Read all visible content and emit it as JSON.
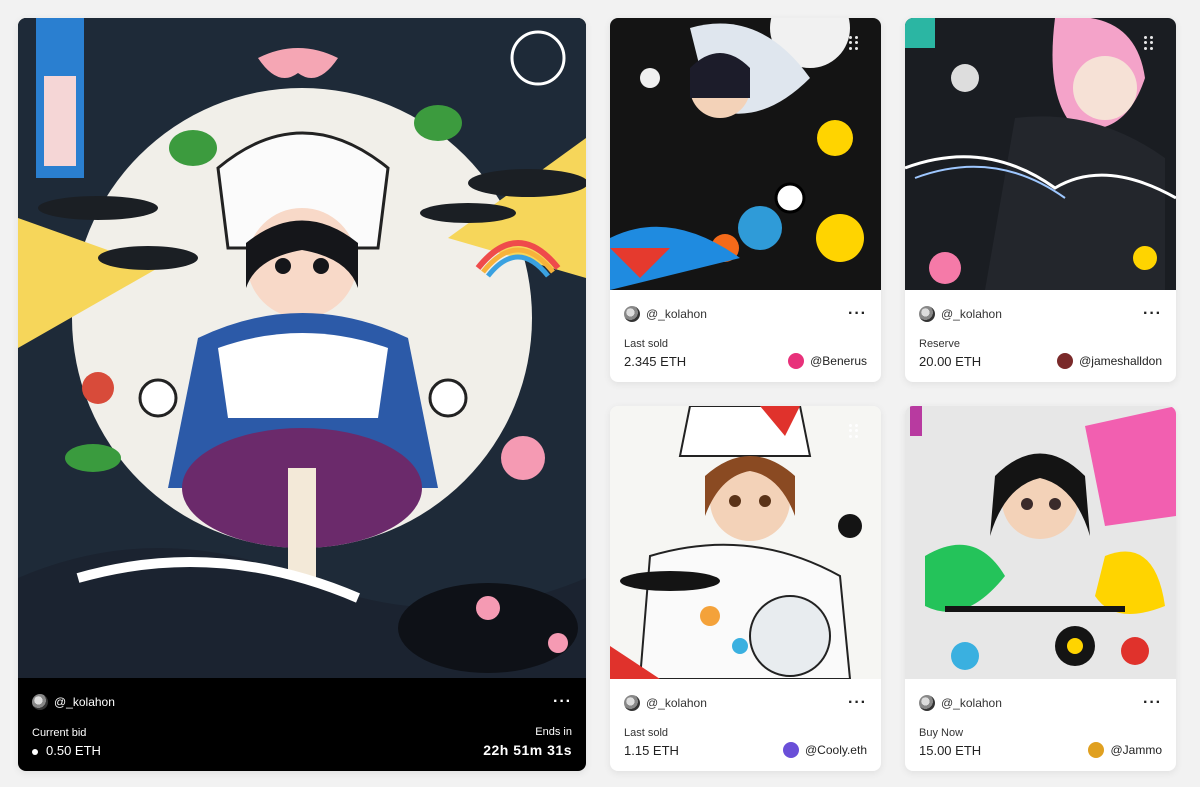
{
  "cards": [
    {
      "creator": "@_kolahon",
      "price_label": "Current bid",
      "price_value": "0.50 ETH",
      "timer_label": "Ends in",
      "timer_value": "22h  51m  31s"
    },
    {
      "creator": "@_kolahon",
      "price_label": "Last sold",
      "price_value": "2.345 ETH",
      "owner": "@Benerus",
      "owner_color": "#e8317a"
    },
    {
      "creator": "@_kolahon",
      "price_label": "Reserve",
      "price_value": "20.00 ETH",
      "owner": "@jameshalldon",
      "owner_color": "#7a2a2a"
    },
    {
      "creator": "@_kolahon",
      "price_label": "Last sold",
      "price_value": "1.15 ETH",
      "owner": "@Cooly.eth",
      "owner_color": "#6a4fd8"
    },
    {
      "creator": "@_kolahon",
      "price_label": "Buy Now",
      "price_value": "15.00 ETH",
      "owner": "@Jammo",
      "owner_color": "#e0a020"
    }
  ],
  "icons": {
    "more": "more-horizontal-icon",
    "avatar": "creator-avatar-icon"
  }
}
